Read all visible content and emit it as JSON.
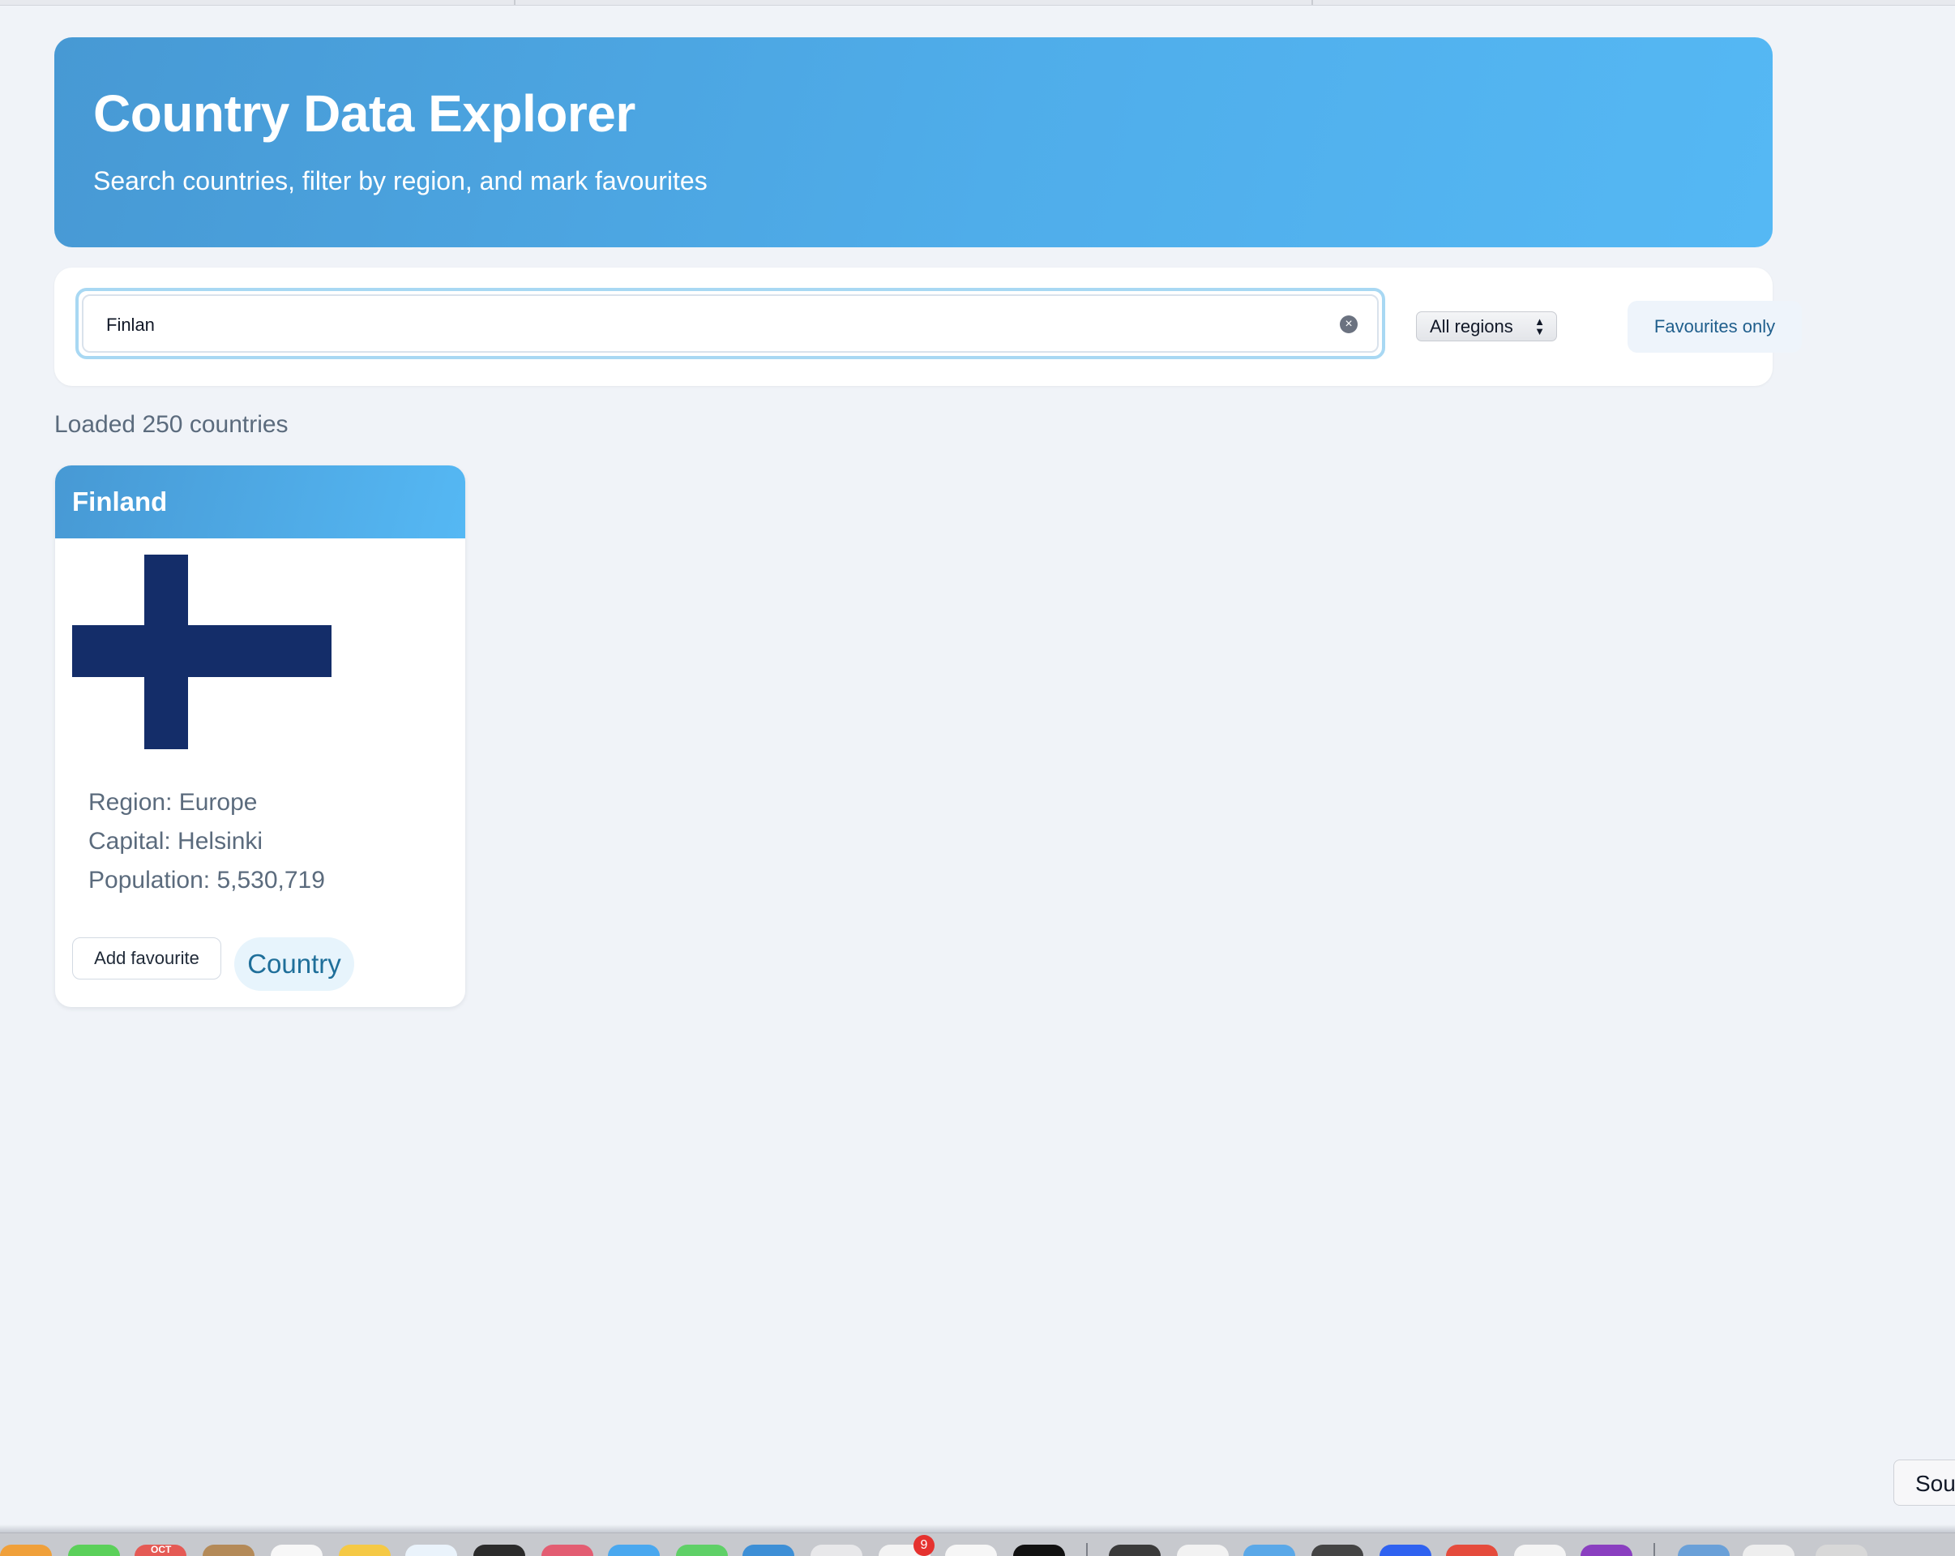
{
  "header": {
    "title": "Country Data Explorer",
    "subtitle": "Search countries, filter by region, and mark favourites"
  },
  "controls": {
    "search_value": "Finlan",
    "search_clear_icon": "close-circle-icon",
    "region_select_value": "All regions",
    "favourites_only_label": "Favourites only"
  },
  "status": {
    "loaded_text": "Loaded 250 countries"
  },
  "countries": [
    {
      "name": "Finland",
      "region_line": "Region: Europe",
      "capital_line": "Capital: Helsinki",
      "population_line": "Population: 5,530,719",
      "add_favourite_label": "Add favourite",
      "tag_label": "Country"
    }
  ],
  "overlay_button": {
    "label": "Sou"
  },
  "dock": {
    "calendar_label": "OCT",
    "badge_count": "9"
  },
  "colors": {
    "header_gradient_start": "#4799d4",
    "header_gradient_end": "#55b8f4",
    "page_background": "#f0f3f8",
    "flag_blue": "#142d69",
    "accent_text": "#1f5e8c"
  }
}
